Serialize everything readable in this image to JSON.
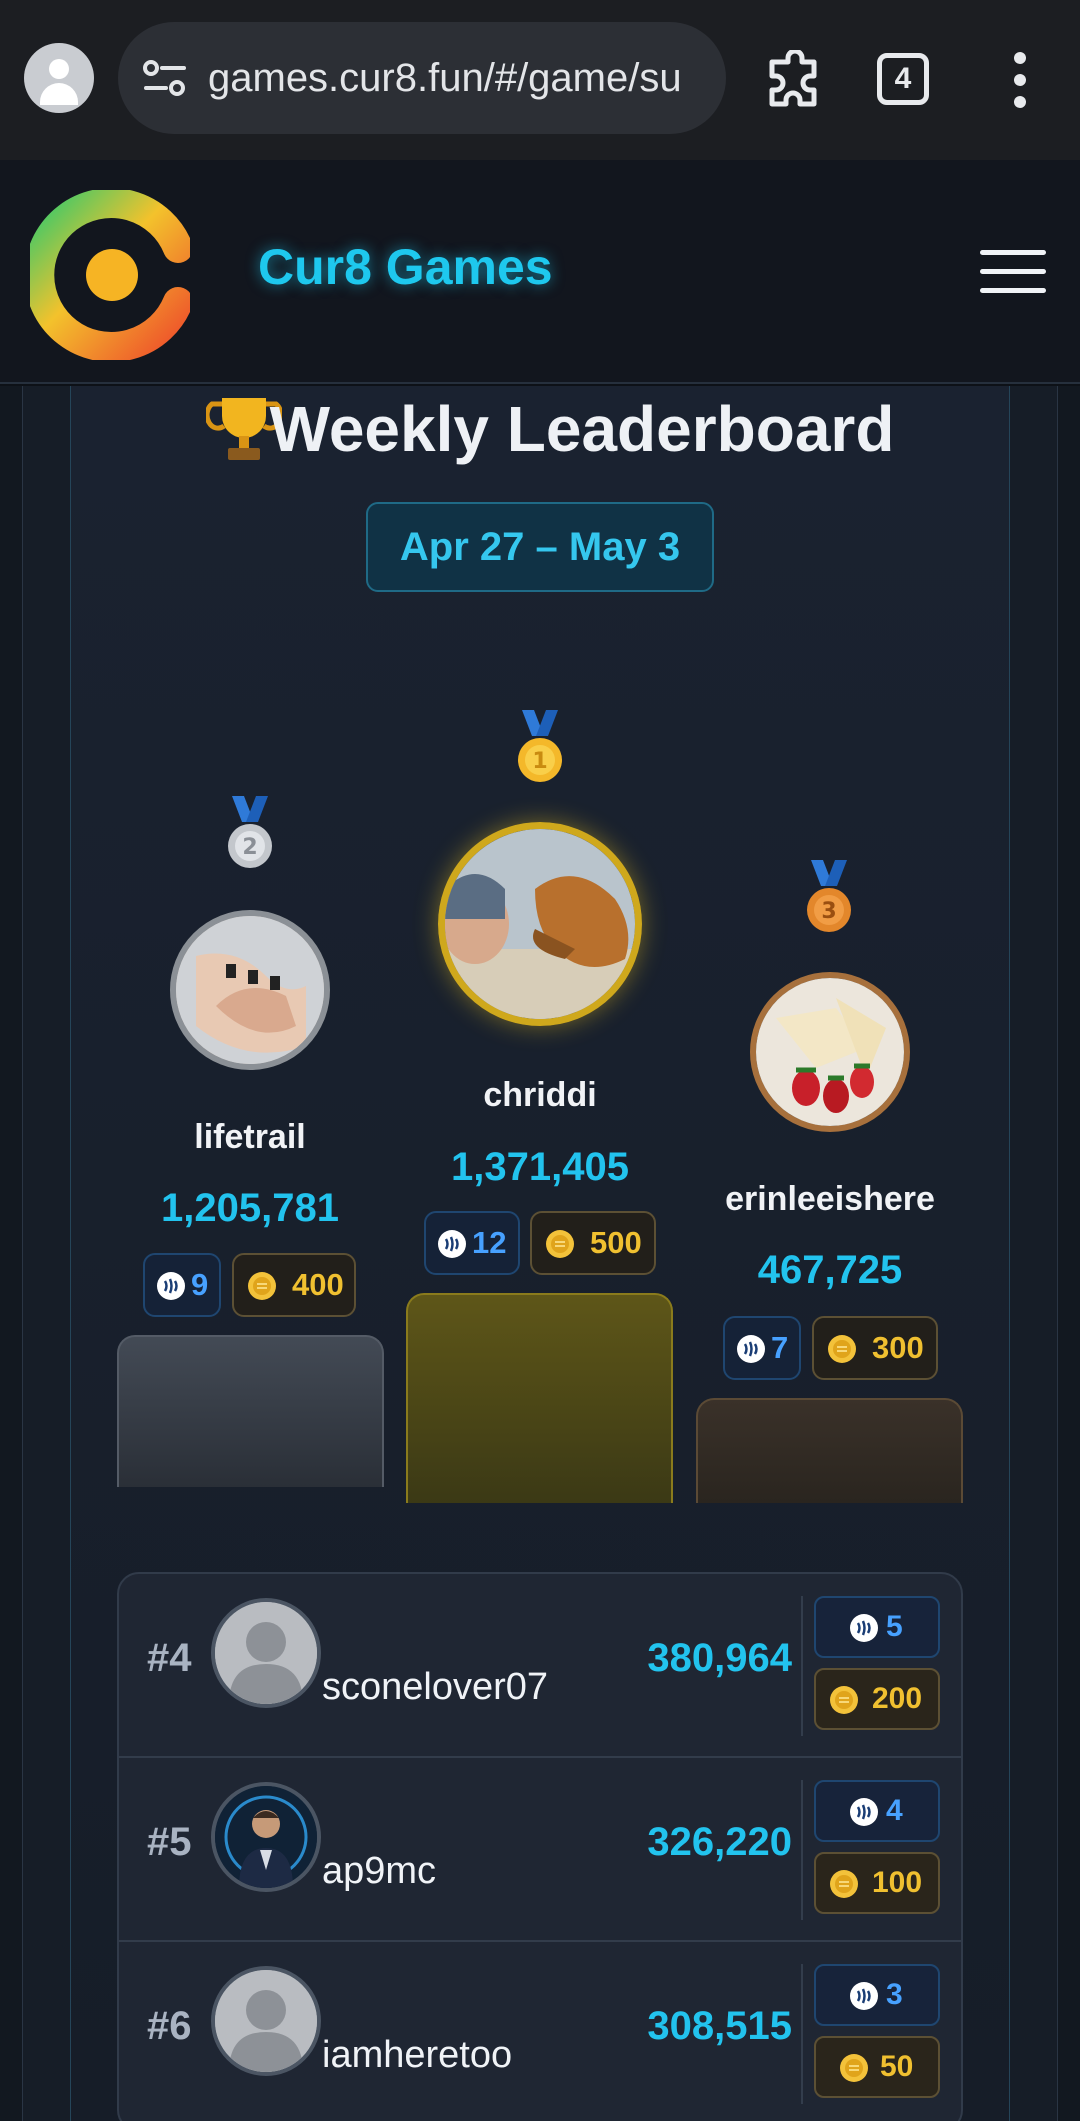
{
  "browser": {
    "url": "games.cur8.fun/#/game/su",
    "tab_count": "4"
  },
  "site": {
    "brand": "Cur8 Games"
  },
  "leaderboard": {
    "title": "Weekly Leaderboard",
    "date_range": "Apr 27 – May 3",
    "podium": [
      {
        "place": 1,
        "name": "chriddi",
        "score": "1,371,405",
        "steem": "12",
        "coins": "500",
        "medal_color": "#f4b82a"
      },
      {
        "place": 2,
        "name": "lifetrail",
        "score": "1,205,781",
        "steem": "9",
        "coins": "400",
        "medal_color": "#c3c7cc"
      },
      {
        "place": 3,
        "name": "erinleeishere",
        "score": "467,725",
        "steem": "7",
        "coins": "300",
        "medal_color": "#e3872b"
      }
    ],
    "rows": [
      {
        "rank": "#4",
        "name": "sconelover07",
        "score": "380,964",
        "steem": "5",
        "coins": "200",
        "avatar": "default-avatar"
      },
      {
        "rank": "#5",
        "name": "ap9mc",
        "score": "326,220",
        "steem": "4",
        "coins": "100",
        "avatar": "photo-avatar"
      },
      {
        "rank": "#6",
        "name": "iamheretoo",
        "score": "308,515",
        "steem": "3",
        "coins": "50",
        "avatar": "default-avatar"
      }
    ]
  },
  "colors": {
    "accent": "#22c3ee",
    "gold": "#f0c030",
    "steem": "#47a1ff",
    "background": "#0d1117"
  }
}
